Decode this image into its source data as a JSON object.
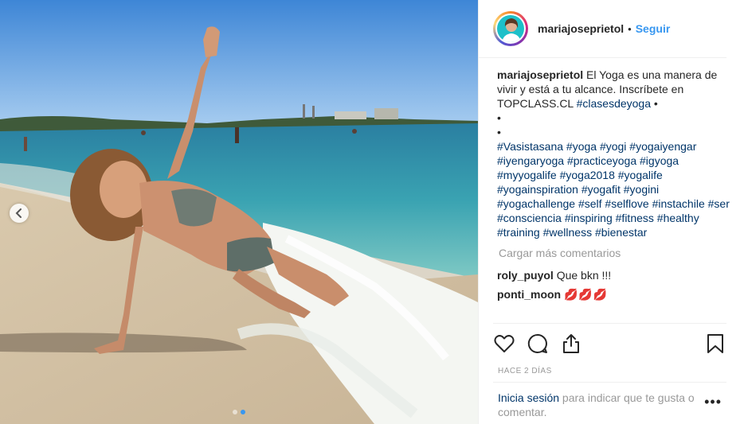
{
  "post": {
    "username": "mariajoseprietol",
    "separator": "•",
    "follow_label": "Seguir",
    "caption": {
      "username": "mariajoseprietol",
      "text_before": " El Yoga es una manera de vivir y está a tu alcance. Inscríbete en TOPCLASS.CL ",
      "first_tag": "#clasesdeyoga",
      "trail": " •",
      "bullet_1": "•",
      "bullet_2": "•",
      "hashtags": "#Vasistasana #yoga #yogi #yogaiyengar #iyengaryoga #practiceyoga #igyoga #myyogalife #yoga2018 #yogalife #yogainspiration #yogafit #yogini #yogachallenge #self #selflove #instachile #ser #consciencia #inspiring #fitness #healthy #training #wellness #bienestar"
    },
    "load_more": "Cargar más comentarios",
    "comments": [
      {
        "user": "roly_puyol",
        "text": "Que bkn !!!"
      },
      {
        "user": "ponti_moon",
        "text": "💋💋💋"
      }
    ],
    "timestamp": "HACE 2 DÍAS",
    "login_link": "Inicia sesión",
    "login_rest": " para indicar que te gusta o comentar.",
    "more_menu": "•••"
  },
  "icons": [
    "heart-icon",
    "comment-icon",
    "share-icon",
    "bookmark-icon",
    "chevron-left-icon"
  ],
  "colors": {
    "link_blue": "#3897f0",
    "hashtag": "#003569",
    "muted": "#999999"
  },
  "carousel": {
    "slides": 2,
    "active": 2
  }
}
